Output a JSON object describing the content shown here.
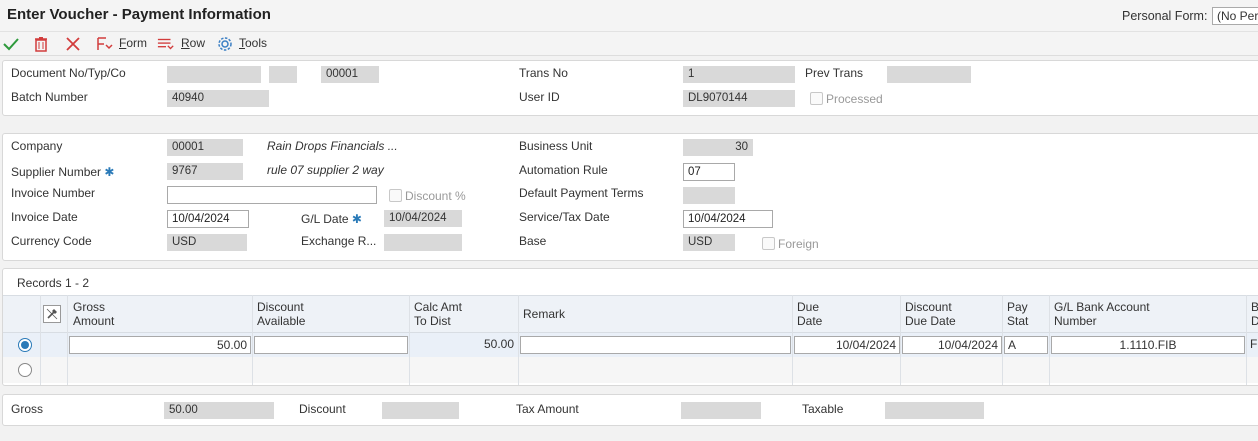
{
  "window": {
    "title": "Enter Voucher - Payment Information",
    "personal_form_label": "Personal Form:",
    "personal_form_value": "(No Pers"
  },
  "toolbar": {
    "form_pre": "",
    "form_u": "F",
    "form_post": "orm",
    "row_pre": "",
    "row_u": "R",
    "row_post": "ow",
    "tools_pre": "",
    "tools_u": "T",
    "tools_post": "ools"
  },
  "header": {
    "document_label": "Document No/Typ/Co",
    "document_no": "",
    "document_type": "",
    "document_co": "00001",
    "trans_no_label": "Trans No",
    "trans_no": "1",
    "prev_trans_label": "Prev Trans",
    "prev_trans": "",
    "batch_label": "Batch Number",
    "batch_number": "40940",
    "user_id_label": "User ID",
    "user_id": "DL9070144",
    "processed_label": "Processed"
  },
  "detail": {
    "company_label": "Company",
    "company": "00001",
    "company_name": "Rain Drops Financials ...",
    "business_unit_label": "Business Unit",
    "business_unit": "30",
    "supplier_label": "Supplier Number",
    "supplier_number": "9767",
    "supplier_name": "rule 07 supplier 2 way",
    "automation_label": "Automation Rule",
    "automation_rule": "07",
    "invoice_number_label": "Invoice Number",
    "invoice_number": "",
    "discount_pct_label": "Discount %",
    "payment_terms_label": "Default Payment Terms",
    "payment_terms": "",
    "invoice_date_label": "Invoice Date",
    "invoice_date": "10/04/2024",
    "gl_date_label": "G/L Date",
    "gl_date": "10/04/2024",
    "service_tax_label": "Service/Tax Date",
    "service_tax_date": "10/04/2024",
    "currency_label": "Currency Code",
    "currency": "USD",
    "exchange_label": "Exchange R...",
    "exchange_rate": "",
    "base_label": "Base",
    "base": "USD",
    "foreign_label": "Foreign"
  },
  "grid": {
    "records": "Records 1 - 2",
    "headers": {
      "gross_1": "Gross",
      "gross_2": "Amount",
      "disc_1": "Discount",
      "disc_2": "Available",
      "calc_1": "Calc Amt",
      "calc_2": "To Dist",
      "remark": "Remark",
      "due_1": "Due",
      "due_2": "Date",
      "ddue_1": "Discount",
      "ddue_2": "Due Date",
      "pay_1": "Pay",
      "pay_2": "Stat",
      "glb_1": "G/L Bank Account",
      "glb_2": "Number",
      "b_1": "B",
      "b_2": "D"
    },
    "row1": {
      "gross_amount": "50.00",
      "discount_available": "",
      "calc_amt": "50.00",
      "remark": "",
      "due_date": "10/04/2024",
      "discount_due_date": "10/04/2024",
      "pay_stat": "A",
      "gl_bank_account": "1.1110.FIB",
      "extra": "Fi"
    }
  },
  "totals": {
    "gross_label": "Gross",
    "gross": "50.00",
    "discount_label": "Discount",
    "discount": "",
    "tax_label": "Tax Amount",
    "tax": "",
    "taxable_label": "Taxable",
    "taxable": ""
  }
}
